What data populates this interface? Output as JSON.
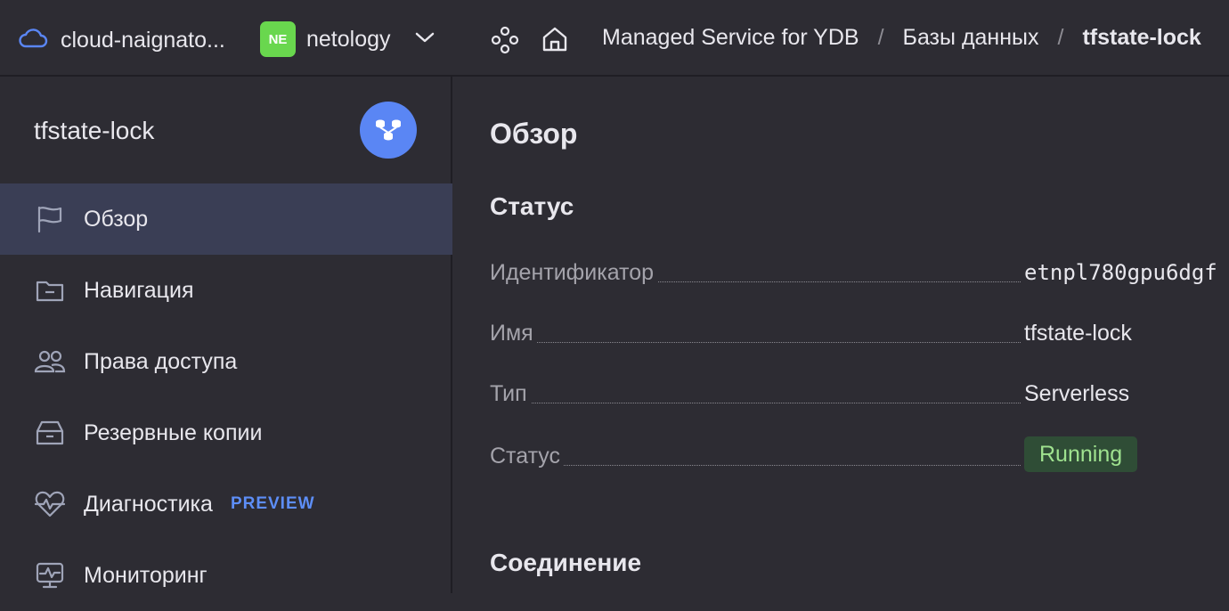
{
  "topbar": {
    "cloud_name": "cloud-naignato...",
    "folder_badge": "NE",
    "folder_name": "netology",
    "breadcrumbs": [
      {
        "label": "Managed Service for YDB"
      },
      {
        "label": "Базы данных"
      },
      {
        "label": "tfstate-lock"
      }
    ],
    "separator": "/"
  },
  "sidebar": {
    "title": "tfstate-lock",
    "items": [
      {
        "label": "Обзор",
        "icon": "flag-icon",
        "active": true
      },
      {
        "label": "Навигация",
        "icon": "folder-icon"
      },
      {
        "label": "Права доступа",
        "icon": "users-icon"
      },
      {
        "label": "Резервные копии",
        "icon": "archive-icon"
      },
      {
        "label": "Диагностика",
        "icon": "heart-pulse-icon",
        "tag": "PREVIEW"
      },
      {
        "label": "Мониторинг",
        "icon": "monitor-icon"
      }
    ]
  },
  "main": {
    "title": "Обзор",
    "status_section": "Статус",
    "rows": [
      {
        "key": "Идентификатор",
        "value": "etnpl780gpu6dgf"
      },
      {
        "key": "Имя",
        "value": "tfstate-lock"
      },
      {
        "key": "Тип",
        "value": "Serverless"
      },
      {
        "key": "Статус",
        "value": "Running"
      }
    ],
    "connection_section": "Соединение"
  },
  "colors": {
    "background": "#2d2c33",
    "active_nav": "#3a3e55",
    "accent": "#5a86f4",
    "folder_badge": "#69d74e",
    "status_running_bg": "#2f4d36",
    "status_running_text": "#9fe28f"
  }
}
